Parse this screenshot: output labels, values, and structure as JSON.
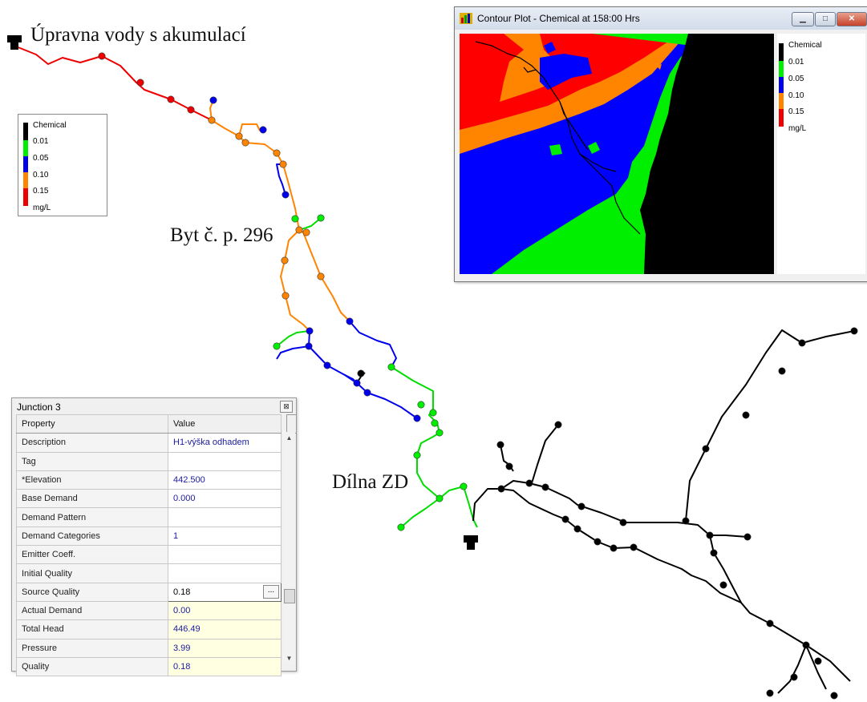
{
  "map_labels": {
    "reservoir_label": "Úpravna vody s akumulací",
    "house_label": "Byt č. p. 296",
    "workshop_label": "Dílna ZD"
  },
  "legend": {
    "title": "Chemical",
    "levels": [
      "0.01",
      "0.05",
      "0.10",
      "0.15"
    ],
    "unit": "mg/L"
  },
  "colors": {
    "black": "#000000",
    "green": "#00ee00",
    "blue": "#0000ee",
    "orange": "#ff8400",
    "red": "#ee0000"
  },
  "contour_window": {
    "title": "Contour Plot - Chemical at 158:00 Hrs",
    "minimize_icon": "minimize-icon",
    "maximize_icon": "maximize-icon",
    "close_icon": "close-icon"
  },
  "junction_panel": {
    "title": "Junction 3",
    "col_property": "Property",
    "col_value": "Value",
    "rows": [
      {
        "property": "Description",
        "value": "H1-výška odhadem"
      },
      {
        "property": "Tag",
        "value": ""
      },
      {
        "property": "*Elevation",
        "value": "442.500"
      },
      {
        "property": "Base Demand",
        "value": "0.000"
      },
      {
        "property": "Demand Pattern",
        "value": ""
      },
      {
        "property": "Demand Categories",
        "value": "1"
      },
      {
        "property": "Emitter Coeff.",
        "value": ""
      },
      {
        "property": "Initial Quality",
        "value": ""
      },
      {
        "property": "Source Quality",
        "value": "0.18"
      },
      {
        "property": "Actual Demand",
        "value": "0.00"
      },
      {
        "property": "Total Head",
        "value": "446.49"
      },
      {
        "property": "Pressure",
        "value": "3.99"
      },
      {
        "property": "Quality",
        "value": "0.18"
      }
    ],
    "dots_label": "..."
  }
}
